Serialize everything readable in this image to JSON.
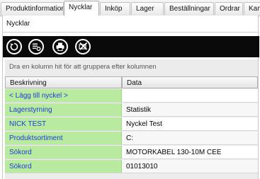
{
  "tabs": [
    {
      "label": "Produktinformation",
      "active": false
    },
    {
      "label": "Nycklar",
      "active": true
    },
    {
      "label": "Inköp",
      "active": false
    },
    {
      "label": "Lager",
      "active": false
    },
    {
      "label": "Beställningar",
      "active": false
    },
    {
      "label": "Ordrar",
      "active": false
    },
    {
      "label": "Kampa",
      "active": false
    }
  ],
  "panel": {
    "title": "Nycklar"
  },
  "toolbar": {
    "buttons": [
      {
        "name": "refresh-icon"
      },
      {
        "name": "edit-list-icon"
      },
      {
        "name": "print-icon"
      },
      {
        "name": "delete-icon"
      }
    ]
  },
  "grid": {
    "group_hint": "Dra en kolumn hit för att gruppera efter kolumnen",
    "columns": [
      "Beskrivning",
      "Data"
    ],
    "add_row_label": "< Lägg till nyckel >",
    "rows": [
      {
        "key": "Lagerstyrning",
        "value": "Statistik"
      },
      {
        "key": "NICK TEST",
        "value": "Nyckel Test"
      },
      {
        "key": "Produktsortiment",
        "value": "C:"
      },
      {
        "key": "Sökord",
        "value": "MOTORKABEL 130-10M CEE"
      },
      {
        "key": "Sökord",
        "value": "01013010"
      }
    ]
  },
  "colors": {
    "key_bg": "#b8eaa0",
    "key_text": "#1a3fd0",
    "toolbar_bg": "#0a0a0a"
  }
}
